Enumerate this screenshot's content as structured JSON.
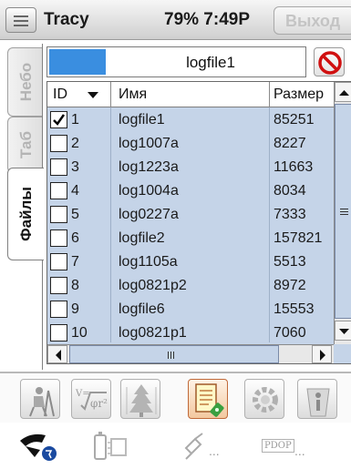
{
  "titlebar": {
    "app_name": "Tracy",
    "status": "79% 7:49P",
    "exit_label": "Выход"
  },
  "tabs": [
    {
      "label": "Небо",
      "active": false
    },
    {
      "label": "Таб",
      "active": false
    },
    {
      "label": "Файлы",
      "active": true
    }
  ],
  "file_box": {
    "file_name": "logfile1",
    "swatch_color": "#3a8ee0"
  },
  "table": {
    "columns": [
      "ID",
      "Имя",
      "Размер"
    ],
    "rows": [
      {
        "checked": true,
        "id": "1",
        "name": "logfile1",
        "size": "85251"
      },
      {
        "checked": false,
        "id": "2",
        "name": "log1007a",
        "size": "8227"
      },
      {
        "checked": false,
        "id": "3",
        "name": "log1223a",
        "size": "11663"
      },
      {
        "checked": false,
        "id": "4",
        "name": "log1004a",
        "size": "8034"
      },
      {
        "checked": false,
        "id": "5",
        "name": "log0227a",
        "size": "7333"
      },
      {
        "checked": false,
        "id": "6",
        "name": "logfile2",
        "size": "157821"
      },
      {
        "checked": false,
        "id": "7",
        "name": "log1105a",
        "size": "5513"
      },
      {
        "checked": false,
        "id": "8",
        "name": "log0821p2",
        "size": "8972"
      },
      {
        "checked": false,
        "id": "9",
        "name": "logfile6",
        "size": "15553"
      },
      {
        "checked": false,
        "id": "10",
        "name": "log0821p1",
        "size": "7060"
      }
    ]
  },
  "toolbar": {
    "tools": [
      {
        "name": "surveyor-tool"
      },
      {
        "name": "formula-tool"
      },
      {
        "name": "tree-tool"
      },
      {
        "name": "notepad-gps-tool",
        "active": true
      },
      {
        "name": "settings-gear-tool"
      },
      {
        "name": "info-tool"
      }
    ]
  },
  "statusbar": {
    "gps_text": "...",
    "pdop_label": "PDOP",
    "pdop_value": "..."
  },
  "colors": {
    "table_bg": "#c5d4e8",
    "accent_orange": "#c06a3a",
    "forbid_red": "#d01010"
  }
}
